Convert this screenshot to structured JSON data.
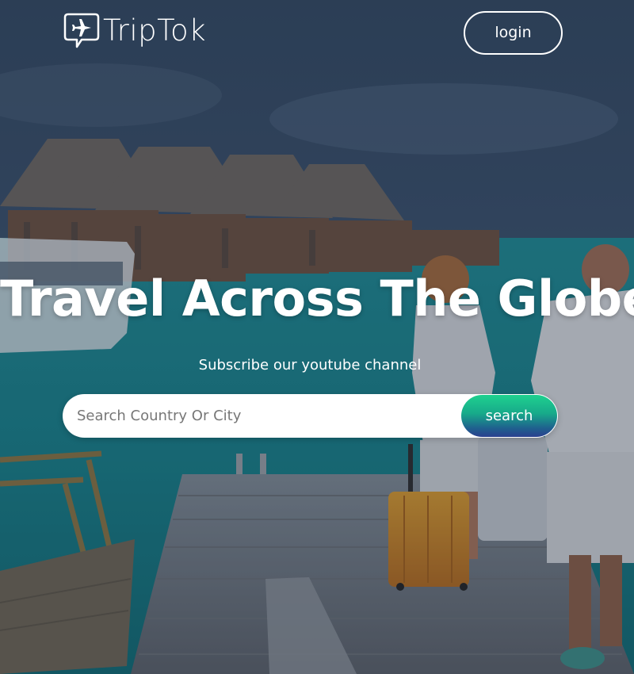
{
  "nav": {
    "brand": "TripTok",
    "brand_icon": "plane-chat-icon",
    "login_label": "login"
  },
  "hero": {
    "headline": "Travel Across The Globe",
    "subtitle": "Subscribe our youtube channel",
    "background_image": "resort-pier-travelers-photo"
  },
  "search": {
    "placeholder": "Search Country Or City",
    "value": "",
    "button_label": "search",
    "icon": "search-icon"
  },
  "colors": {
    "overlay": "#1e283c",
    "text": "#ffffff",
    "search_button_gradient_top": "#1fd18f",
    "search_button_gradient_bottom": "#2b3f8f"
  }
}
